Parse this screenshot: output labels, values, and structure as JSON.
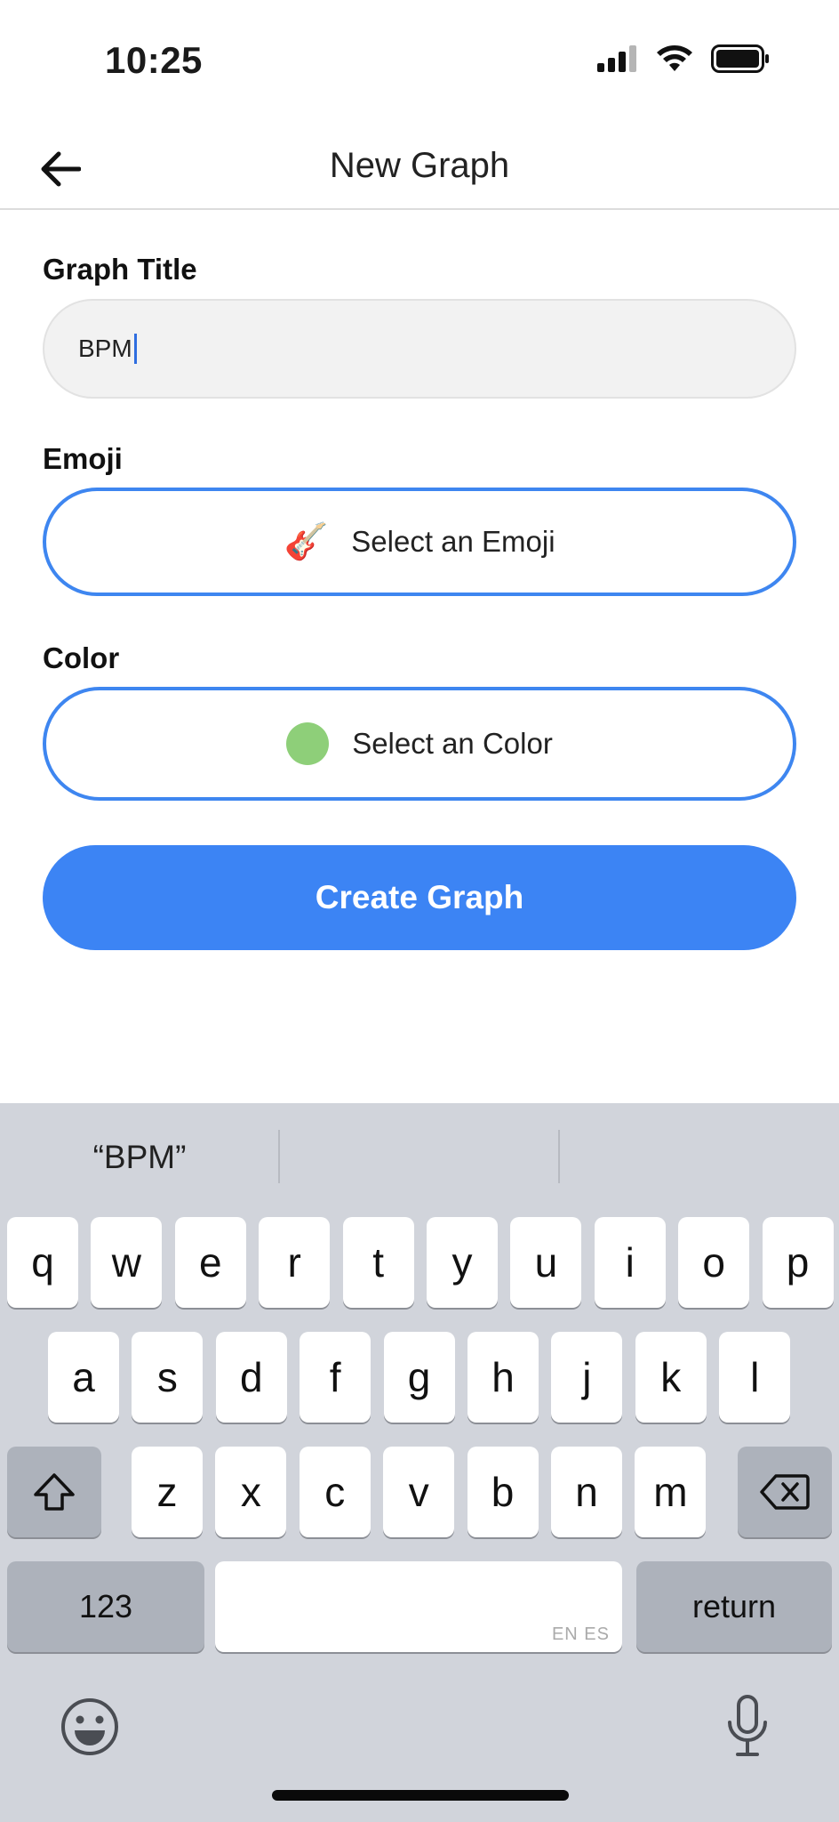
{
  "status_bar": {
    "time": "10:25"
  },
  "header": {
    "title": "New Graph"
  },
  "form": {
    "title_label": "Graph Title",
    "title_value": "BPM",
    "emoji_label": "Emoji",
    "emoji_glyph": "🎸",
    "emoji_button": "Select an Emoji",
    "color_label": "Color",
    "color_button": "Select an Color",
    "selected_color": "#8ecf79",
    "submit_label": "Create Graph"
  },
  "keyboard": {
    "suggestions": [
      "“BPM”",
      "",
      ""
    ],
    "row1": [
      "q",
      "w",
      "e",
      "r",
      "t",
      "y",
      "u",
      "i",
      "o",
      "p"
    ],
    "row2": [
      "a",
      "s",
      "d",
      "f",
      "g",
      "h",
      "j",
      "k",
      "l"
    ],
    "row3": [
      "z",
      "x",
      "c",
      "v",
      "b",
      "n",
      "m"
    ],
    "numbers_key": "123",
    "space_lang": "EN ES",
    "return_key": "return"
  },
  "colors": {
    "accent": "#3c84f4",
    "keyboard_bg": "#d1d4db"
  }
}
